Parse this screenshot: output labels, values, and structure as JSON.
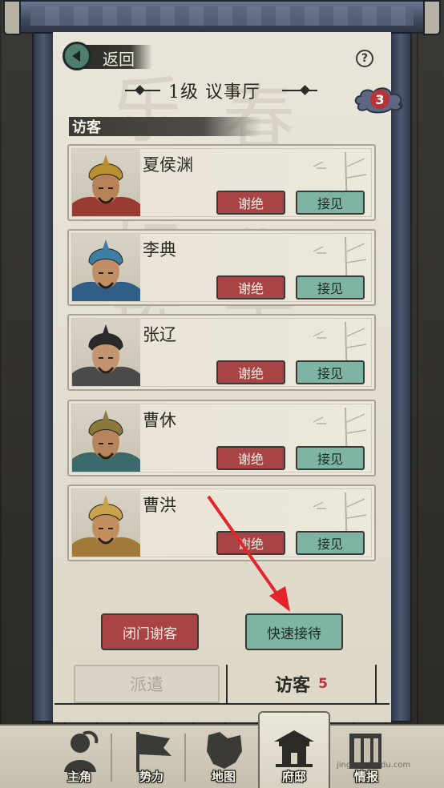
{
  "header": {
    "back_label": "返回",
    "help_symbol": "?",
    "title": "1级 议事厅",
    "badge_count": "3"
  },
  "section": {
    "label": "访客"
  },
  "visitors": [
    {
      "name": "夏侯渊",
      "refuse_label": "谢绝",
      "receive_label": "接见",
      "helmet": "#b9902e",
      "robe": "#9a3b32",
      "skin": "#b7825a"
    },
    {
      "name": "李典",
      "refuse_label": "谢绝",
      "receive_label": "接见",
      "helmet": "#3d7fa3",
      "robe": "#2f5f86",
      "skin": "#c08f66"
    },
    {
      "name": "张辽",
      "refuse_label": "谢绝",
      "receive_label": "接见",
      "helmet": "#2a2a2a",
      "robe": "#4a4a4a",
      "skin": "#c29470"
    },
    {
      "name": "曹休",
      "refuse_label": "谢绝",
      "receive_label": "接见",
      "helmet": "#8c7a3a",
      "robe": "#3c6a6a",
      "skin": "#b8845e"
    },
    {
      "name": "曹洪",
      "refuse_label": "谢绝",
      "receive_label": "接见",
      "helmet": "#c9a34a",
      "robe": "#a17a3a",
      "skin": "#c28e5e"
    }
  ],
  "actions": {
    "close_door_label": "闭门谢客",
    "quick_receive_label": "快速接待"
  },
  "tabs": {
    "dispatch_label": "派遣",
    "visitor_label": "访客",
    "visitor_count": "5"
  },
  "bottom_nav": [
    {
      "label": "主角",
      "icon": "hero-icon"
    },
    {
      "label": "势力",
      "icon": "flag-icon"
    },
    {
      "label": "地图",
      "icon": "map-icon"
    },
    {
      "label": "府邸",
      "icon": "mansion-icon"
    },
    {
      "label": "情报",
      "icon": "intel-icon"
    }
  ],
  "watermark": "jingyan.baidu.com",
  "colors": {
    "refuse": "#a84446",
    "receive": "#7db4a3",
    "badge": "#b73438"
  }
}
